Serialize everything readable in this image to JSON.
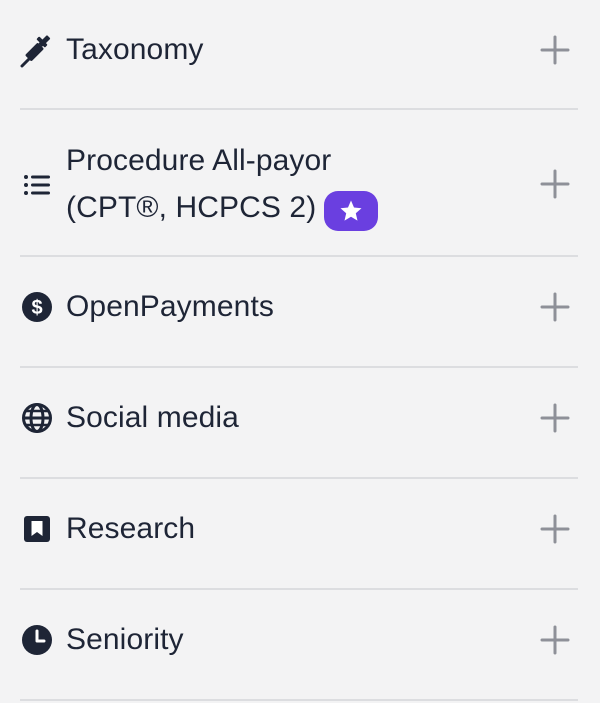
{
  "filters": {
    "items": [
      {
        "label": "Taxonomy",
        "icon": "syringe-icon"
      },
      {
        "label_line1": "Procedure All-payor",
        "label_line2": "(CPT®, HCPCS 2)",
        "icon": "list-icon",
        "badge_icon": "star-icon"
      },
      {
        "label": "OpenPayments",
        "icon": "dollar-circle-icon"
      },
      {
        "label": "Social media",
        "icon": "globe-icon"
      },
      {
        "label": "Research",
        "icon": "bookmark-icon"
      },
      {
        "label": "Seniority",
        "icon": "clock-icon"
      }
    ],
    "expand_icon": "plus-icon",
    "colors": {
      "text": "#1e2536",
      "icon_muted": "#8e9098",
      "divider": "#dcdde0",
      "badge": "#6a3fe0",
      "background": "#f3f3f4"
    }
  }
}
